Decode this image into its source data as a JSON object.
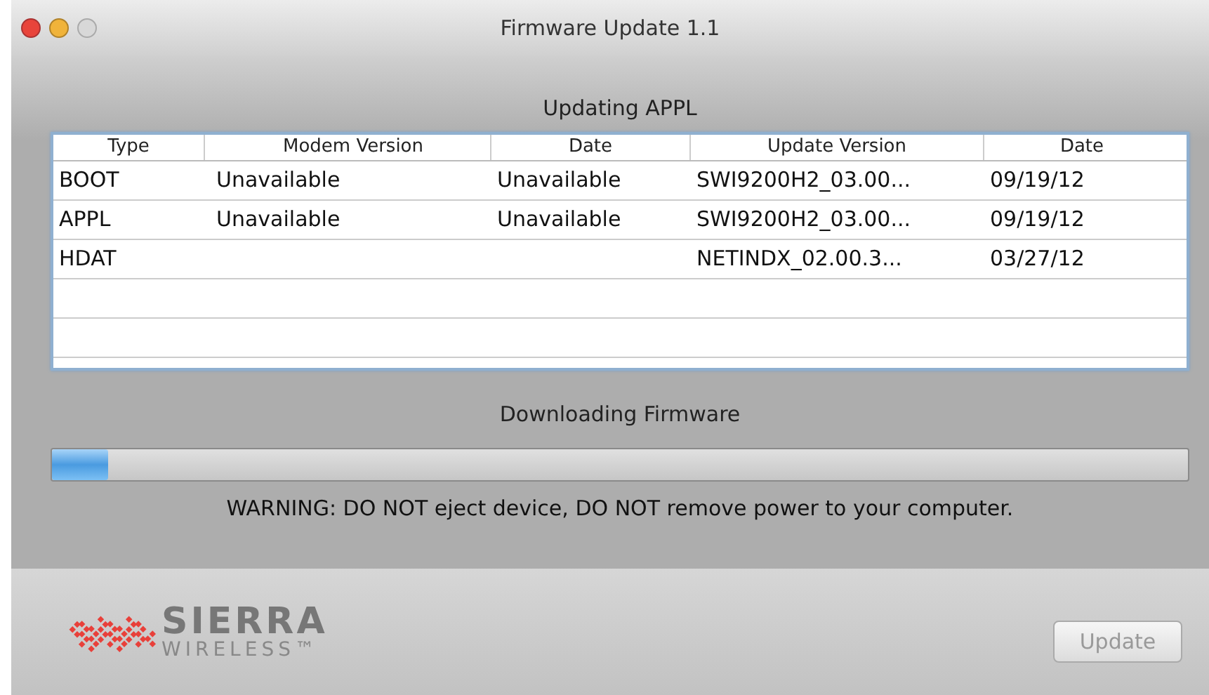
{
  "window": {
    "title": "Firmware Update 1.1"
  },
  "heading": "Updating APPL",
  "table": {
    "columns": [
      "Type",
      "Modem Version",
      "Date",
      "Update Version",
      "Date"
    ],
    "rows": [
      [
        "BOOT",
        "Unavailable",
        "Unavailable",
        "SWI9200H2_03.00...",
        "09/19/12"
      ],
      [
        "APPL",
        "Unavailable",
        "Unavailable",
        "SWI9200H2_03.00...",
        "09/19/12"
      ],
      [
        "HDAT",
        "",
        "",
        "NETINDX_02.00.3...",
        "03/27/12"
      ]
    ]
  },
  "progress": {
    "label": "Downloading Firmware",
    "level": 0.05
  },
  "warning": "WARNING: DO NOT eject device, DO NOT remove power to your computer.",
  "logo": {
    "line_1": "SIERRA",
    "line_2": "WIRELESS™"
  },
  "buttons": [
    {
      "label": "Update",
      "disabled": true
    }
  ]
}
